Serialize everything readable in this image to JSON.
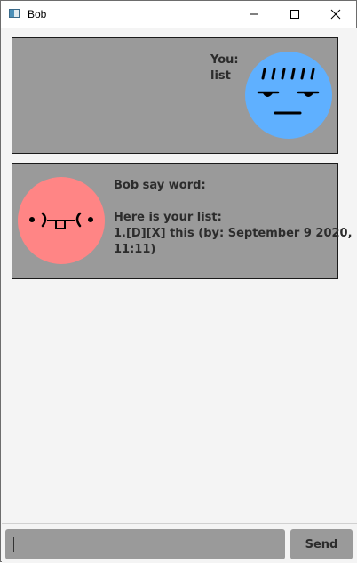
{
  "window": {
    "title": "Bob",
    "icon": "app-window-icon"
  },
  "colors": {
    "bubble_bg": "#9a9a9a",
    "user_avatar": "#5fb0ff",
    "bot_avatar": "#ff8585",
    "input_bg": "#9a9a9a",
    "send_bg": "#9a9a9a"
  },
  "messages": [
    {
      "sender": "user",
      "label": "You:",
      "text": "list",
      "avatar": "annoyed-face-avatar"
    },
    {
      "sender": "bot",
      "label": "Bob say word:",
      "line1": "Here is your list:",
      "line2": "1.[D][X] this (by: September 9 2020,\n11:11)",
      "avatar": "kaomoji-face-avatar"
    }
  ],
  "input": {
    "value": "",
    "placeholder": ""
  },
  "send_label": "Send"
}
